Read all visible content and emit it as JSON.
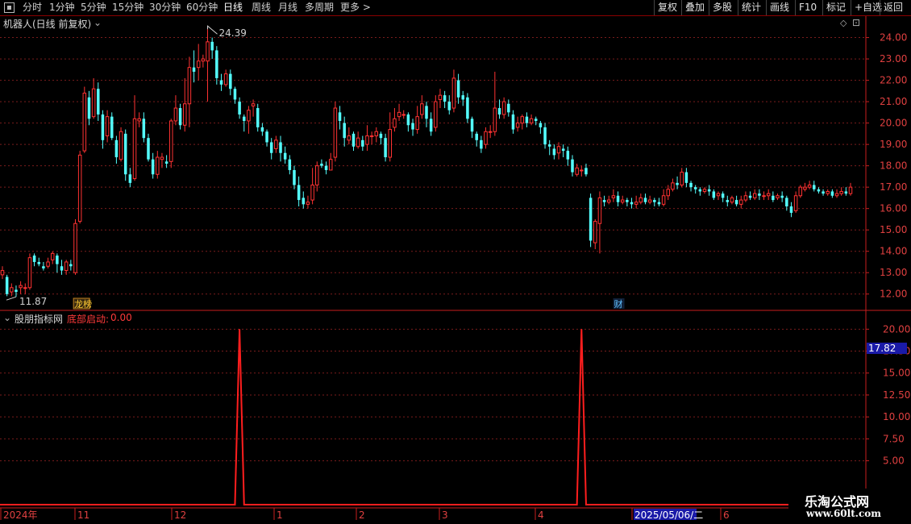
{
  "toolbar": {
    "periods": [
      "分时",
      "1分钟",
      "5分钟",
      "15分钟",
      "30分钟",
      "60分钟",
      "日线",
      "周线",
      "月线",
      "多周期",
      "更多 >"
    ],
    "active": "日线",
    "right_buttons": [
      "复权",
      "叠加",
      "多股",
      "统计",
      "画线",
      "F10",
      "标记",
      "+自选",
      "返回"
    ]
  },
  "main": {
    "title": "机器人(日线 前复权)",
    "high_label": "24.39",
    "low_label": "11.87",
    "marker_bang": "龙榜",
    "marker_cai": "财",
    "price_ticks": [
      "24.00",
      "23.00",
      "22.00",
      "21.00",
      "20.00",
      "19.00",
      "18.00",
      "17.00",
      "16.00",
      "15.00",
      "14.00",
      "13.00",
      "12.00"
    ]
  },
  "indicator": {
    "name": "股朋指标网",
    "line_label": "底部启动:",
    "line_value": "0.00",
    "ticks": [
      "20.00",
      "17.50",
      "15.00",
      "12.50",
      "10.00",
      "7.50",
      "5.00"
    ],
    "current_value": "17.82"
  },
  "dates": {
    "labels": [
      "2024年",
      "11",
      "12",
      "1",
      "2",
      "3",
      "4",
      "2025/05/06/二",
      "6"
    ]
  },
  "watermark": {
    "line1": "乐淘公式网",
    "line2": "www.60lt.com"
  },
  "colors": {
    "up": "#ff3232",
    "down": "#54ffff",
    "grid": "#7a1c1c",
    "axis": "#c81e1e",
    "indicator_line": "#ff1e1e",
    "date_highlight": "#1a1aa8"
  },
  "chart_data": {
    "type": "candlestick",
    "y_range": [
      11.5,
      24.7
    ],
    "indicator_range": [
      0,
      21.5
    ],
    "candles": [
      [
        12.9,
        13.1,
        12.7,
        13.3
      ],
      [
        12.8,
        12.0,
        11.9,
        12.9
      ],
      [
        12.1,
        12.3,
        11.9,
        12.5
      ],
      [
        12.2,
        12.1,
        11.87,
        12.4
      ],
      [
        12.3,
        12.4,
        12.0,
        12.6
      ],
      [
        12.3,
        12.3,
        12.0,
        12.5
      ],
      [
        12.3,
        13.7,
        12.2,
        13.9
      ],
      [
        13.8,
        13.5,
        13.3,
        13.9
      ],
      [
        13.5,
        13.4,
        13.3,
        13.7
      ],
      [
        13.3,
        13.2,
        13.1,
        13.5
      ],
      [
        13.3,
        13.5,
        13.2,
        13.7
      ],
      [
        13.6,
        13.9,
        13.4,
        14.0
      ],
      [
        13.8,
        13.4,
        13.0,
        13.9
      ],
      [
        13.3,
        13.1,
        12.9,
        13.6
      ],
      [
        13.1,
        13.5,
        12.9,
        13.6
      ],
      [
        13.4,
        13.3,
        13.1,
        13.6
      ],
      [
        13.0,
        15.3,
        12.9,
        15.5
      ],
      [
        15.4,
        18.5,
        15.3,
        18.7
      ],
      [
        18.7,
        21.4,
        18.6,
        21.7
      ],
      [
        21.2,
        20.2,
        19.9,
        21.5
      ],
      [
        20.3,
        21.6,
        20.2,
        22.1
      ],
      [
        21.6,
        20.4,
        20.1,
        21.9
      ],
      [
        20.4,
        19.2,
        18.8,
        20.6
      ],
      [
        19.4,
        20.3,
        19.1,
        20.6
      ],
      [
        20.3,
        19.3,
        19.2,
        20.5
      ],
      [
        19.2,
        18.4,
        18.1,
        19.4
      ],
      [
        18.3,
        19.6,
        18.2,
        19.8
      ],
      [
        19.5,
        17.6,
        17.3,
        19.7
      ],
      [
        17.6,
        17.2,
        17.0,
        17.9
      ],
      [
        17.4,
        20.2,
        17.3,
        21.3
      ],
      [
        20.1,
        20.2,
        19.8,
        20.5
      ],
      [
        20.2,
        19.3,
        19.1,
        20.5
      ],
      [
        19.3,
        18.3,
        18.2,
        19.5
      ],
      [
        18.3,
        17.6,
        17.4,
        18.6
      ],
      [
        17.6,
        18.4,
        17.4,
        18.7
      ],
      [
        18.3,
        18.4,
        17.9,
        18.6
      ],
      [
        18.2,
        18.1,
        17.9,
        18.5
      ],
      [
        18.2,
        20.1,
        17.9,
        20.2
      ],
      [
        20.1,
        20.7,
        19.9,
        21.3
      ],
      [
        20.7,
        19.9,
        19.7,
        20.9
      ],
      [
        19.9,
        20.9,
        19.6,
        22.1
      ],
      [
        20.9,
        22.6,
        19.8,
        23.1
      ],
      [
        22.6,
        22.4,
        21.9,
        23.4
      ],
      [
        22.6,
        22.9,
        22.0,
        23.7
      ],
      [
        22.9,
        23.0,
        22.6,
        23.2
      ],
      [
        22.9,
        23.8,
        21.0,
        24.39
      ],
      [
        23.8,
        23.4,
        23.0,
        24.0
      ],
      [
        23.4,
        22.1,
        21.8,
        23.6
      ],
      [
        22.0,
        21.8,
        21.5,
        22.3
      ],
      [
        21.8,
        22.3,
        21.7,
        22.5
      ],
      [
        22.3,
        21.6,
        21.3,
        22.5
      ],
      [
        21.6,
        21.1,
        20.9,
        21.7
      ],
      [
        21.0,
        20.4,
        20.2,
        21.2
      ],
      [
        20.3,
        20.1,
        19.6,
        20.4
      ],
      [
        20.1,
        20.6,
        19.5,
        20.8
      ],
      [
        20.8,
        20.9,
        20.3,
        21.1
      ],
      [
        20.7,
        19.8,
        19.6,
        20.9
      ],
      [
        19.8,
        19.6,
        19.4,
        20.0
      ],
      [
        19.6,
        19.1,
        18.9,
        19.7
      ],
      [
        19.1,
        18.6,
        18.3,
        19.3
      ],
      [
        18.8,
        19.2,
        18.6,
        19.4
      ],
      [
        19.1,
        18.6,
        18.2,
        19.4
      ],
      [
        18.6,
        18.3,
        18.1,
        18.9
      ],
      [
        18.3,
        17.8,
        17.6,
        18.5
      ],
      [
        17.8,
        17.1,
        16.9,
        18.0
      ],
      [
        17.1,
        16.4,
        16.1,
        17.5
      ],
      [
        16.5,
        16.2,
        16.0,
        16.8
      ],
      [
        16.2,
        16.3,
        16.0,
        16.6
      ],
      [
        16.4,
        17.1,
        16.2,
        17.9
      ],
      [
        17.1,
        18.0,
        16.8,
        18.2
      ],
      [
        18.1,
        18.0,
        17.9,
        18.3
      ],
      [
        18.0,
        17.8,
        17.6,
        18.2
      ],
      [
        17.8,
        18.3,
        17.8,
        18.6
      ],
      [
        18.4,
        20.7,
        18.2,
        21.0
      ],
      [
        20.5,
        20.1,
        19.7,
        20.8
      ],
      [
        20.0,
        19.3,
        18.9,
        20.3
      ],
      [
        19.2,
        19.4,
        19.0,
        19.8
      ],
      [
        19.5,
        18.9,
        18.7,
        19.6
      ],
      [
        18.9,
        19.3,
        18.8,
        19.6
      ],
      [
        19.2,
        18.9,
        18.7,
        19.4
      ],
      [
        19.0,
        19.4,
        18.7,
        19.9
      ],
      [
        19.4,
        19.4,
        19.0,
        19.6
      ],
      [
        19.4,
        19.6,
        19.1,
        19.8
      ],
      [
        19.5,
        19.3,
        19.0,
        19.6
      ],
      [
        19.3,
        18.4,
        18.2,
        19.5
      ],
      [
        18.4,
        19.7,
        18.2,
        20.5
      ],
      [
        19.8,
        20.2,
        19.6,
        20.7
      ],
      [
        20.3,
        20.5,
        20.1,
        20.9
      ],
      [
        20.4,
        20.4,
        20.2,
        20.6
      ],
      [
        20.4,
        19.9,
        19.6,
        20.5
      ],
      [
        20.0,
        19.7,
        19.4,
        20.2
      ],
      [
        19.7,
        20.3,
        19.5,
        20.8
      ],
      [
        20.4,
        20.9,
        20.2,
        21.3
      ],
      [
        20.8,
        20.2,
        19.8,
        21.0
      ],
      [
        20.2,
        19.6,
        19.4,
        20.5
      ],
      [
        19.8,
        21.0,
        19.6,
        21.3
      ],
      [
        21.1,
        21.3,
        20.7,
        21.6
      ],
      [
        21.3,
        21.0,
        20.7,
        21.5
      ],
      [
        21.0,
        20.6,
        20.4,
        21.3
      ],
      [
        20.7,
        22.1,
        20.5,
        22.5
      ],
      [
        22.0,
        21.2,
        20.9,
        22.3
      ],
      [
        21.3,
        21.1,
        20.8,
        21.5
      ],
      [
        21.2,
        20.2,
        20.0,
        21.4
      ],
      [
        20.2,
        19.6,
        19.3,
        20.3
      ],
      [
        19.5,
        19.2,
        18.9,
        19.6
      ],
      [
        19.2,
        18.8,
        18.6,
        19.4
      ],
      [
        19.0,
        19.6,
        18.8,
        19.8
      ],
      [
        19.6,
        19.6,
        19.3,
        19.9
      ],
      [
        19.6,
        20.7,
        19.4,
        22.4
      ],
      [
        20.7,
        20.4,
        20.2,
        21.1
      ],
      [
        20.4,
        21.0,
        20.2,
        21.2
      ],
      [
        20.9,
        20.5,
        20.3,
        21.1
      ],
      [
        20.4,
        19.7,
        19.5,
        20.6
      ],
      [
        19.8,
        20.0,
        19.6,
        20.3
      ],
      [
        20.0,
        20.3,
        19.7,
        20.4
      ],
      [
        20.3,
        20.0,
        19.8,
        20.5
      ],
      [
        20.0,
        20.2,
        19.9,
        20.4
      ],
      [
        20.2,
        20.1,
        19.9,
        20.3
      ],
      [
        20.0,
        19.8,
        19.5,
        20.1
      ],
      [
        19.8,
        19.0,
        18.8,
        20.0
      ],
      [
        19.0,
        18.9,
        18.5,
        19.2
      ],
      [
        18.8,
        18.5,
        18.3,
        19.0
      ],
      [
        18.6,
        18.9,
        18.3,
        19.1
      ],
      [
        18.8,
        18.7,
        18.4,
        19.0
      ],
      [
        18.7,
        18.3,
        18.0,
        18.9
      ],
      [
        18.3,
        17.7,
        17.5,
        18.5
      ],
      [
        17.6,
        17.9,
        17.5,
        18.1
      ],
      [
        17.8,
        17.8,
        17.5,
        18.0
      ],
      [
        17.9,
        17.6,
        17.5,
        18.1
      ],
      [
        16.5,
        14.5,
        14.2,
        16.7
      ],
      [
        14.4,
        15.4,
        14.1,
        15.5
      ],
      [
        15.3,
        16.5,
        13.9,
        16.8
      ],
      [
        16.4,
        16.3,
        16.1,
        16.6
      ],
      [
        16.3,
        16.4,
        16.2,
        16.6
      ],
      [
        16.5,
        16.6,
        16.3,
        16.9
      ],
      [
        16.6,
        16.3,
        16.1,
        16.8
      ],
      [
        16.3,
        16.4,
        16.2,
        16.6
      ],
      [
        16.4,
        16.3,
        16.1,
        16.5
      ],
      [
        16.3,
        16.2,
        16.0,
        16.5
      ],
      [
        16.2,
        16.3,
        16.0,
        16.6
      ],
      [
        16.3,
        16.5,
        16.2,
        16.7
      ],
      [
        16.5,
        16.3,
        16.2,
        16.7
      ],
      [
        16.3,
        16.4,
        16.2,
        16.6
      ],
      [
        16.4,
        16.3,
        16.1,
        16.5
      ],
      [
        16.3,
        16.2,
        16.1,
        16.5
      ],
      [
        16.2,
        16.6,
        16.1,
        16.9
      ],
      [
        16.6,
        16.9,
        16.4,
        17.1
      ],
      [
        16.9,
        17.2,
        16.8,
        17.4
      ],
      [
        17.2,
        17.1,
        16.9,
        17.5
      ],
      [
        17.1,
        17.7,
        17.0,
        17.9
      ],
      [
        17.7,
        17.2,
        17.0,
        17.9
      ],
      [
        17.2,
        17.0,
        16.8,
        17.3
      ],
      [
        17.0,
        16.9,
        16.7,
        17.1
      ],
      [
        16.9,
        16.8,
        16.6,
        17.0
      ],
      [
        16.8,
        16.9,
        16.7,
        17.0
      ],
      [
        16.9,
        16.8,
        16.6,
        17.1
      ],
      [
        16.8,
        16.5,
        16.4,
        16.9
      ],
      [
        16.6,
        16.7,
        16.4,
        16.8
      ],
      [
        16.7,
        16.5,
        16.3,
        16.8
      ],
      [
        16.4,
        16.3,
        16.1,
        16.6
      ],
      [
        16.3,
        16.5,
        16.2,
        16.6
      ],
      [
        16.4,
        16.2,
        16.1,
        16.6
      ],
      [
        16.2,
        16.4,
        16.0,
        16.6
      ],
      [
        16.4,
        16.6,
        16.3,
        16.8
      ],
      [
        16.6,
        16.5,
        16.4,
        16.8
      ],
      [
        16.5,
        16.7,
        16.4,
        16.9
      ],
      [
        16.7,
        16.6,
        16.4,
        16.9
      ],
      [
        16.6,
        16.6,
        16.4,
        16.8
      ],
      [
        16.6,
        16.7,
        16.4,
        16.9
      ],
      [
        16.6,
        16.4,
        16.3,
        16.8
      ],
      [
        16.5,
        16.6,
        16.4,
        16.7
      ],
      [
        16.6,
        16.5,
        16.3,
        16.8
      ],
      [
        16.5,
        16.1,
        15.9,
        16.6
      ],
      [
        16.1,
        15.8,
        15.6,
        16.3
      ],
      [
        15.9,
        16.6,
        15.8,
        16.8
      ],
      [
        16.6,
        17.0,
        16.5,
        17.1
      ],
      [
        16.9,
        17.0,
        16.8,
        17.2
      ],
      [
        17.0,
        17.1,
        16.9,
        17.3
      ],
      [
        17.1,
        16.9,
        16.8,
        17.3
      ],
      [
        16.9,
        16.8,
        16.7,
        17.0
      ],
      [
        16.8,
        16.7,
        16.6,
        16.9
      ],
      [
        16.7,
        16.8,
        16.6,
        16.9
      ],
      [
        16.8,
        16.6,
        16.5,
        16.9
      ],
      [
        16.6,
        16.7,
        16.5,
        16.9
      ],
      [
        16.7,
        16.8,
        16.6,
        17.0
      ],
      [
        16.8,
        16.7,
        16.6,
        17.0
      ],
      [
        16.7,
        17.0,
        16.6,
        17.2
      ]
    ],
    "spikes": [
      {
        "index": 52,
        "value": 20.0
      },
      {
        "index": 127,
        "value": 20.0
      }
    ]
  }
}
